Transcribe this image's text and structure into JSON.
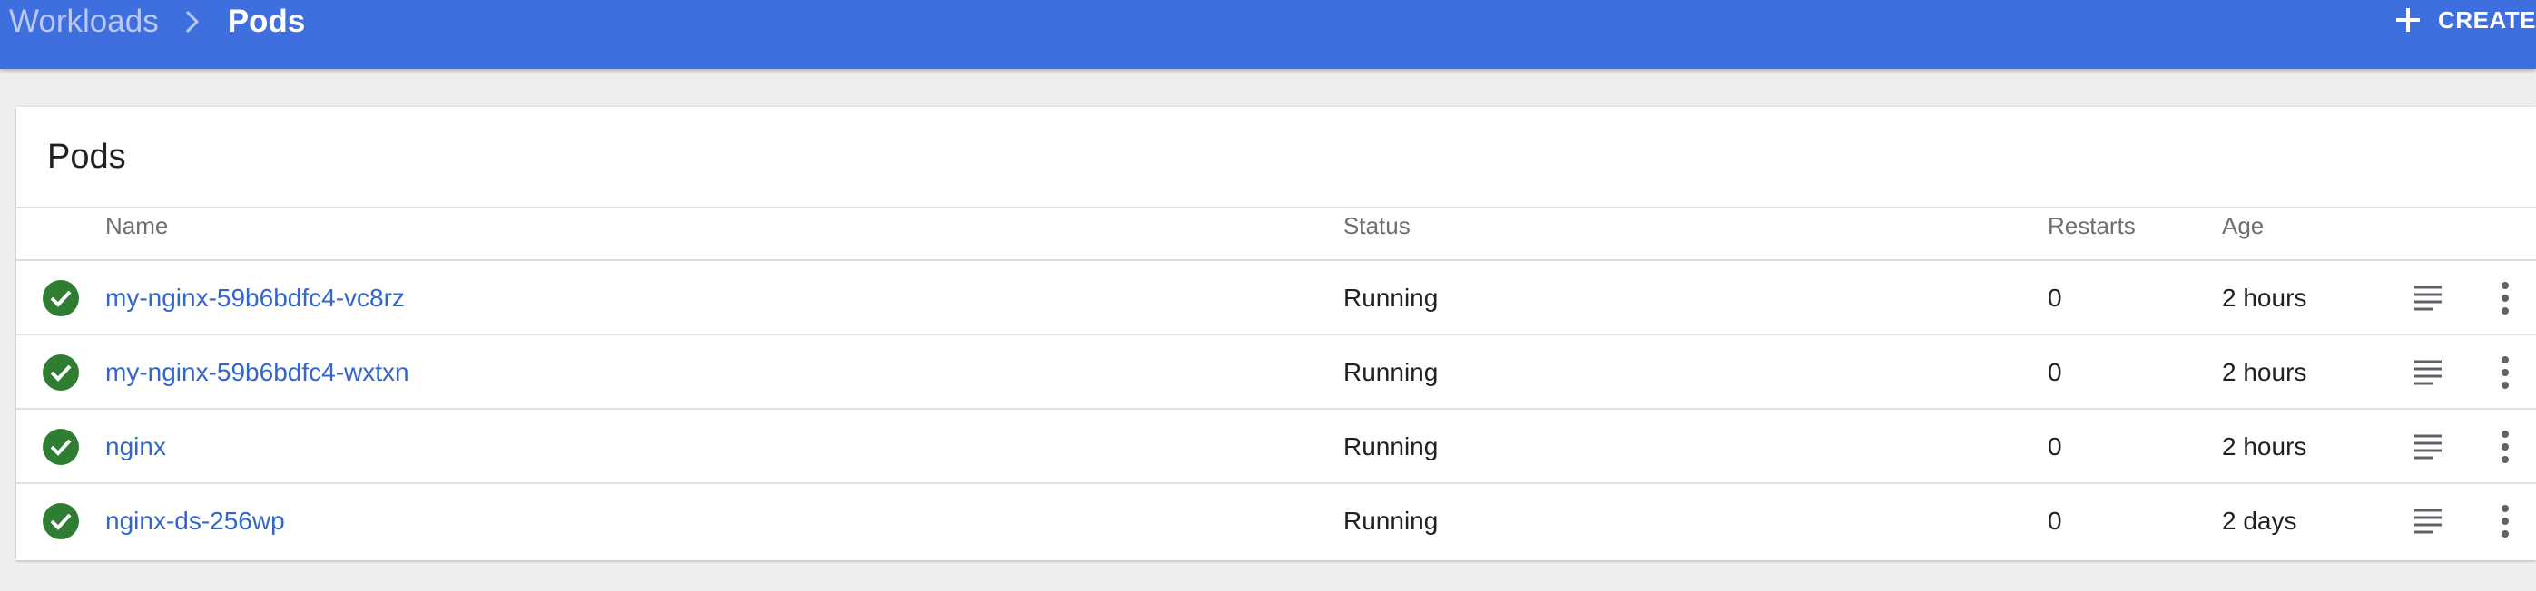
{
  "header": {
    "breadcrumb_parent": "Workloads",
    "breadcrumb_current": "Pods",
    "create_label": "CREATE",
    "color": "#3f6fde"
  },
  "card": {
    "title": "Pods"
  },
  "table": {
    "columns": {
      "name": "Name",
      "status": "Status",
      "restarts": "Restarts",
      "age": "Age"
    },
    "rows": [
      {
        "name": "my-nginx-59b6bdfc4-vc8rz",
        "status": "Running",
        "restarts": "0",
        "age": "2 hours",
        "status_icon": "check-circle-icon",
        "status_color": "#2e7d32"
      },
      {
        "name": "my-nginx-59b6bdfc4-wxtxn",
        "status": "Running",
        "restarts": "0",
        "age": "2 hours",
        "status_icon": "check-circle-icon",
        "status_color": "#2e7d32"
      },
      {
        "name": "nginx",
        "status": "Running",
        "restarts": "0",
        "age": "2 hours",
        "status_icon": "check-circle-icon",
        "status_color": "#2e7d32"
      },
      {
        "name": "nginx-ds-256wp",
        "status": "Running",
        "restarts": "0",
        "age": "2 days",
        "status_icon": "check-circle-icon",
        "status_color": "#2e7d32"
      }
    ]
  },
  "icons": {
    "breadcrumb_separator": "chevron-right-icon",
    "create": "plus-icon",
    "logs": "logs-icon",
    "more": "more-vert-icon"
  }
}
